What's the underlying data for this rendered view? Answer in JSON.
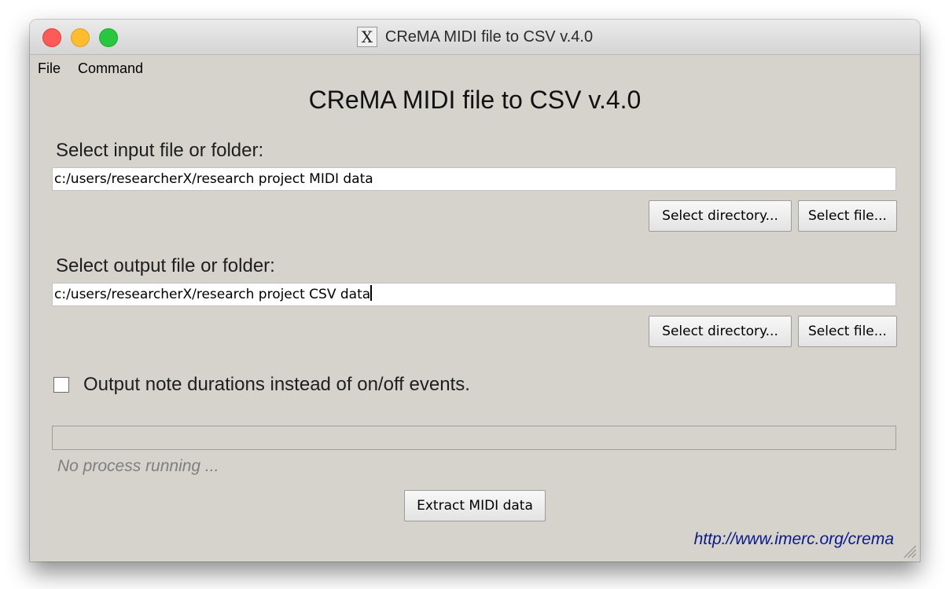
{
  "window": {
    "title": "CReMA MIDI file to CSV v.4.0",
    "app_icon": "X"
  },
  "menu": {
    "items": [
      {
        "label": "File"
      },
      {
        "label": "Command"
      }
    ]
  },
  "heading": "CReMA MIDI file to CSV v.4.0",
  "input_section": {
    "label": "Select input file or folder:",
    "value": "c:/users/researcherX/research project MIDI data",
    "select_directory_label": "Select directory...",
    "select_file_label": "Select file..."
  },
  "output_section": {
    "label": "Select output file or folder:",
    "value": "c:/users/researcherX/research project CSV data",
    "select_directory_label": "Select directory...",
    "select_file_label": "Select file..."
  },
  "options": {
    "durations_label": "Output note durations instead of on/off events.",
    "durations_checked": false
  },
  "progress": {
    "fraction": 0,
    "status_text": "No process running ..."
  },
  "actions": {
    "extract_label": "Extract MIDI data"
  },
  "footer": {
    "link_text": "http://www.imerc.org/crema"
  }
}
